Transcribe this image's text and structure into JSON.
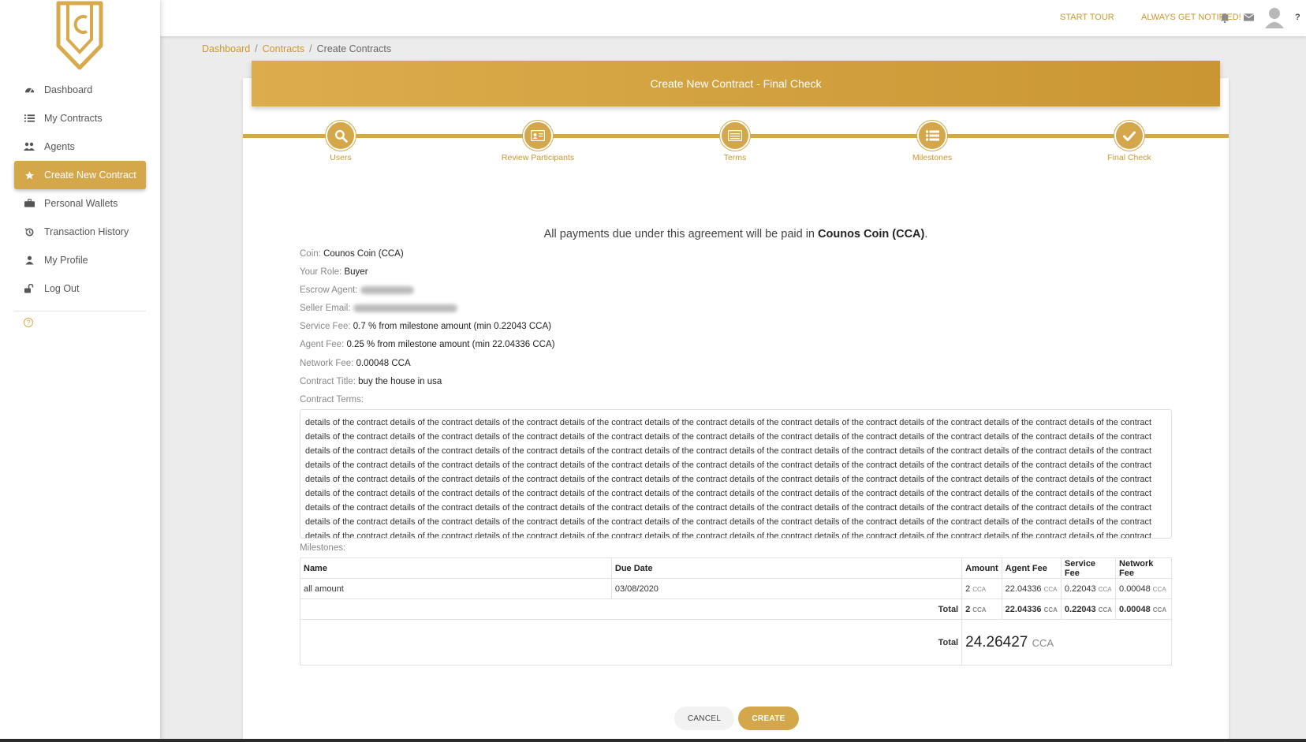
{
  "sidebar": {
    "items": [
      {
        "label": "Dashboard",
        "icon": "tachometer-icon"
      },
      {
        "label": "My Contracts",
        "icon": "list-icon"
      },
      {
        "label": "Agents",
        "icon": "users-icon"
      },
      {
        "label": "Create New Contract",
        "icon": "star-icon",
        "active": true
      },
      {
        "label": "Personal Wallets",
        "icon": "briefcase-icon"
      },
      {
        "label": "Transaction History",
        "icon": "history-icon"
      },
      {
        "label": "My Profile",
        "icon": "user-icon"
      },
      {
        "label": "Log Out",
        "icon": "unlock-icon"
      }
    ],
    "help_glyph": "?"
  },
  "topbar": {
    "start_tour": "START TOUR",
    "always_notified": "ALWAYS GET NOTIFIED!",
    "help": "?"
  },
  "breadcrumb": {
    "items": [
      "Dashboard",
      "Contracts",
      "Create Contracts"
    ],
    "separator": "/"
  },
  "card": {
    "title": "Create New Contract - Final Check"
  },
  "steps": [
    {
      "label": "Users",
      "icon": "search-icon"
    },
    {
      "label": "Review Participants",
      "icon": "id-card-icon"
    },
    {
      "label": "Terms",
      "icon": "document-icon"
    },
    {
      "label": "Milestones",
      "icon": "list-icon"
    },
    {
      "label": "Final Check",
      "icon": "check-icon"
    }
  ],
  "summary": {
    "intro_prefix": "All payments due under this agreement will be paid in",
    "intro_coin": "Counos Coin (CCA)",
    "intro_suffix": ".",
    "coin_label": "Coin:",
    "coin": "Counos Coin (CCA)",
    "role_label": "Your Role:",
    "role": "Buyer",
    "escrow_label": "Escrow Agent:",
    "escrow": "[blurred]",
    "seller_label": "Seller Email:",
    "seller": "[blurred]",
    "service_fee_label": "Service Fee:",
    "service_fee": "0.7 % from milestone amount (min 0.22043 CCA)",
    "agent_fee_label": "Agent Fee:",
    "agent_fee": "0.25 % from milestone amount (min 22.04336 CCA)",
    "network_fee_label": "Network Fee:",
    "network_fee": "0.00048 CCA",
    "title_label": "Contract Title:",
    "title": "buy the house in usa",
    "terms_label": "Contract Terms:",
    "terms": "details of the contract details of the contract details of the contract details of the contract details of the contract details of the contract details of the contract details of the contract details of the contract details of the contract details of the contract details of the contract details of the contract details of the contract details of the contract details of the contract details of the contract details of the contract details of the contract details of the contract details of the contract details of the contract details of the contract details of the contract details of the contract details of the contract details of the contract details of the contract details of the contract details of the contract details of the contract details of the contract details of the contract details of the contract details of the contract details of the contract details of the contract details of the contract details of the contract details of the contract details of the contract details of the contract details of the contract details of the contract details of the contract details of the contract details of the contract details of the contract details of the contract details of the contract details of the contract details of the contract details of the contract details of the contract details of the contract details of the contract details of the contract details of the contract details of the contract details of the contract details of the contract details of the contract details of the contract details of the contract details of the contract details of the contract details of the contract details of the contract details of the contract details of the contract details of the contract details of the contract details of the contract details of the contract details of the contract details of the contract details of the contract details of the contract details of the contract details of the contract details of the contract details of the contract details of the contract details of the contract details of the contract details of the contract details of the contract details of the contract details of the contract details of the contract details of the contract details of the contract details of the contract details of the contract details of the contract details of the contract details of the contract details of the contract details of the contract details of the contract details of the contract details of the contract details of the contract details of the contract"
  },
  "milestones": {
    "label": "Milestones:",
    "headers": [
      "Name",
      "Due Date",
      "Amount",
      "Agent Fee",
      "Service Fee",
      "Network Fee"
    ],
    "unit": "CCA",
    "rows": [
      {
        "name": "all amount",
        "due": "03/08/2020",
        "amount": "2",
        "agent_fee": "22.04336",
        "service_fee": "0.22043",
        "network_fee": "0.00048"
      }
    ],
    "total_label": "Total",
    "total": {
      "amount": "2",
      "agent_fee": "22.04336",
      "service_fee": "0.22043",
      "network_fee": "0.00048"
    },
    "grand_label": "Total",
    "grand_total": "24.26427",
    "grand_unit": "CCA"
  },
  "buttons": {
    "cancel": "CANCEL",
    "create": "CREATE"
  },
  "colors": {
    "accent": "#d3a74a",
    "accent_dark": "#c99632"
  }
}
